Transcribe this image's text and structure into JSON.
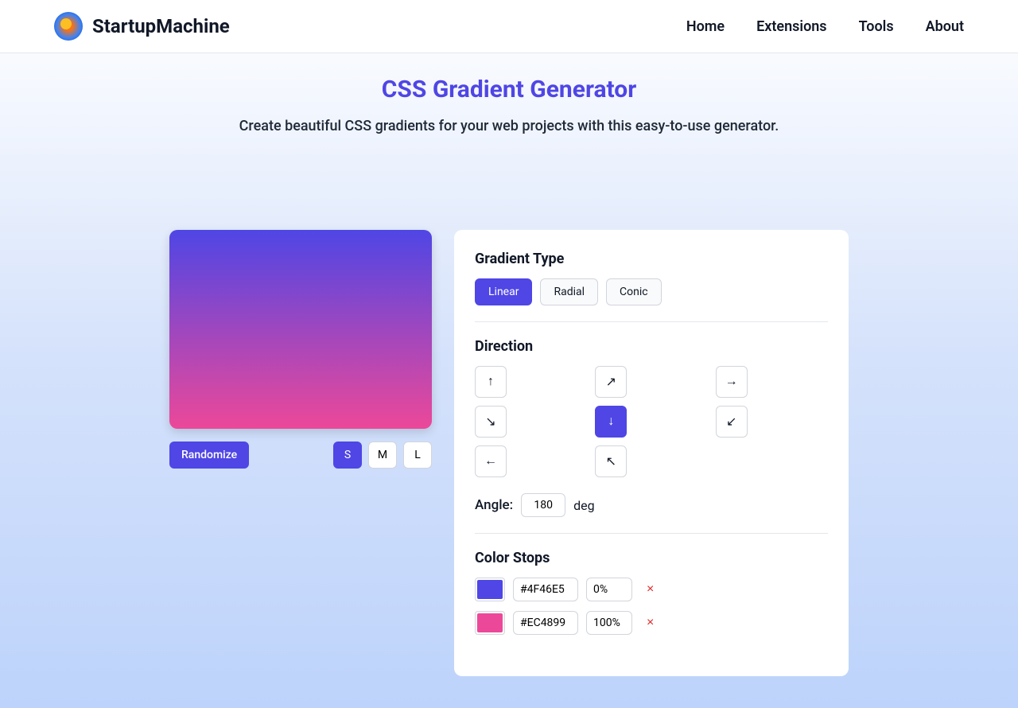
{
  "header": {
    "brand": "StartupMachine",
    "nav": [
      "Home",
      "Extensions",
      "Tools",
      "About"
    ]
  },
  "hero": {
    "title": "CSS Gradient Generator",
    "subtitle": "Create beautiful CSS gradients for your web projects with this easy-to-use generator."
  },
  "preview": {
    "gradient_start": "#4F46E5",
    "gradient_end": "#EC4899",
    "randomize_label": "Randomize",
    "sizes": [
      "S",
      "M",
      "L"
    ],
    "active_size": "S"
  },
  "gradient_type": {
    "title": "Gradient Type",
    "options": [
      "Linear",
      "Radial",
      "Conic"
    ],
    "active": "Linear"
  },
  "direction": {
    "title": "Direction",
    "arrows": [
      "↑",
      "↗",
      "→",
      "↘",
      "↓",
      "↙",
      "←",
      "↖"
    ],
    "active_index": 4,
    "angle_label": "Angle:",
    "angle_value": "180",
    "angle_unit": "deg"
  },
  "color_stops": {
    "title": "Color Stops",
    "stops": [
      {
        "color": "#4F46E5",
        "hex": "#4F46E5",
        "position": "0%"
      },
      {
        "color": "#EC4899",
        "hex": "#EC4899",
        "position": "100%"
      }
    ],
    "remove_label": "×"
  }
}
